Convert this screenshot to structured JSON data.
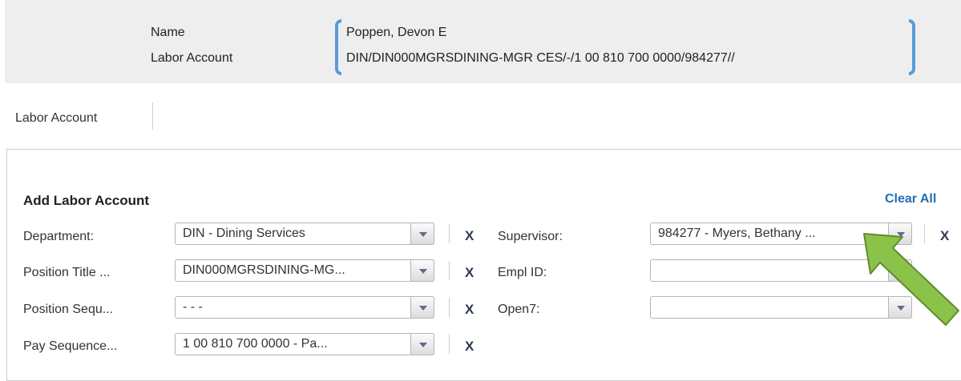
{
  "header": {
    "name_label": "Name",
    "name_value": "Poppen, Devon E",
    "labor_account_label": "Labor Account",
    "labor_account_value": "DIN/DIN000MGRSDINING-MGR CES/-/1 00 810 700 0000/984277//"
  },
  "tabs": {
    "labor_account": "Labor Account"
  },
  "panel": {
    "title": "Add Labor Account",
    "clear_all": "Clear All",
    "fields": {
      "department": {
        "label": "Department:",
        "value": "DIN - Dining Services"
      },
      "position_title": {
        "label": "Position Title ...",
        "value": "DIN000MGRSDINING-MG..."
      },
      "position_sequence": {
        "label": "Position Sequ...",
        "value": "- - -"
      },
      "pay_sequence": {
        "label": "Pay Sequence...",
        "value": "1 00  810  700  0000 - Pa..."
      },
      "supervisor": {
        "label": "Supervisor:",
        "value": "984277 - Myers, Bethany ..."
      },
      "empl_id": {
        "label": "Empl ID:",
        "value": ""
      },
      "open7": {
        "label": "Open7:",
        "value": ""
      }
    },
    "clear_glyph": "X"
  },
  "colors": {
    "accent_blue": "#1f6fb2",
    "bracket": "#5b9bd5",
    "arrow_fill": "#8bc34a",
    "arrow_stroke": "#5e8c2e"
  },
  "icons": {
    "dropdown": "chevron-down-icon",
    "clear": "close-icon",
    "annotation": "green-arrow-icon"
  }
}
